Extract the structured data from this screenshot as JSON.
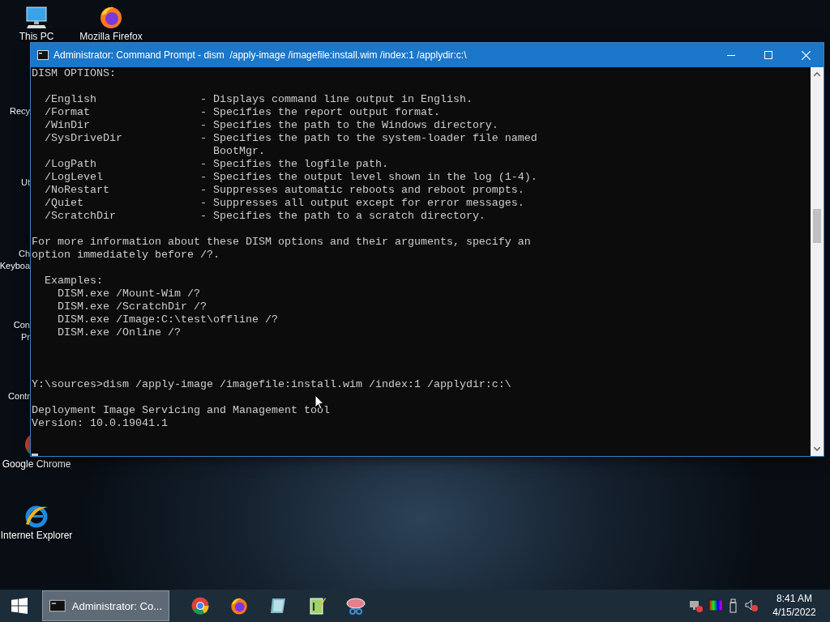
{
  "desktop_icons": [
    {
      "kind": "computer",
      "label_lines": [
        "This PC"
      ]
    },
    {
      "kind": "chrome",
      "label_lines": [
        "Google Chrome"
      ]
    },
    {
      "kind": "ie",
      "label_lines": [
        "Internet Explorer"
      ]
    },
    {
      "kind": "firefox",
      "label_lines": [
        "Mozilla Firefox"
      ]
    }
  ],
  "covered_desktop_icons": [
    {
      "label_lines": [
        "Recy"
      ]
    },
    {
      "label_lines": [
        "Ut"
      ]
    },
    {
      "label_lines": [
        "Ch",
        "Keyboa"
      ]
    },
    {
      "label_lines": [
        "Con",
        "Pr"
      ]
    },
    {
      "label_lines": [
        "Contr"
      ]
    }
  ],
  "window": {
    "title": "Administrator: Command Prompt - dism  /apply-image /imagefile:install.wim /index:1 /applydir:c:\\",
    "console_blocks": [
      {
        "kind": "output",
        "lines": [
          "DISM OPTIONS:"
        ]
      },
      {
        "kind": "output",
        "lines": [
          "  /English                - Displays command line output in English.",
          "  /Format                 - Specifies the report output format.",
          "  /WinDir                 - Specifies the path to the Windows directory.",
          "  /SysDriveDir            - Specifies the path to the system-loader file named",
          "                            BootMgr.",
          "  /LogPath                - Specifies the logfile path.",
          "  /LogLevel               - Specifies the output level shown in the log (1-4).",
          "  /NoRestart              - Suppresses automatic reboots and reboot prompts.",
          "  /Quiet                  - Suppresses all output except for error messages.",
          "  /ScratchDir             - Specifies the path to a scratch directory."
        ]
      },
      {
        "kind": "output",
        "lines": [
          "For more information about these DISM options and their arguments, specify an",
          "option immediately before /?."
        ]
      },
      {
        "kind": "output",
        "lines": [
          "  Examples:",
          "    DISM.exe /Mount-Wim /?",
          "    DISM.exe /ScratchDir /?",
          "    DISM.exe /Image:C:\\test\\offline /?",
          "    DISM.exe /Online /?"
        ]
      },
      {
        "kind": "prompt",
        "lines": [
          "Y:\\sources>dism /apply-image /imagefile:install.wim /index:1 /applydir:c:\\"
        ]
      },
      {
        "kind": "output",
        "lines": [
          "Deployment Image Servicing and Management tool",
          "Version: 10.0.19041.1"
        ]
      }
    ]
  },
  "taskbar": {
    "windows": [
      {
        "label": "Administrator: Co...",
        "selected": true
      }
    ],
    "pinned": [
      {
        "kind": "chrome"
      },
      {
        "kind": "firefox"
      },
      {
        "kind": "tablet"
      },
      {
        "kind": "notepad"
      },
      {
        "kind": "snip"
      }
    ],
    "tray": [
      {
        "kind": "network"
      },
      {
        "kind": "display"
      },
      {
        "kind": "usb"
      },
      {
        "kind": "volume"
      }
    ],
    "clock": {
      "time": "8:41 AM",
      "date": "4/15/2022"
    }
  }
}
